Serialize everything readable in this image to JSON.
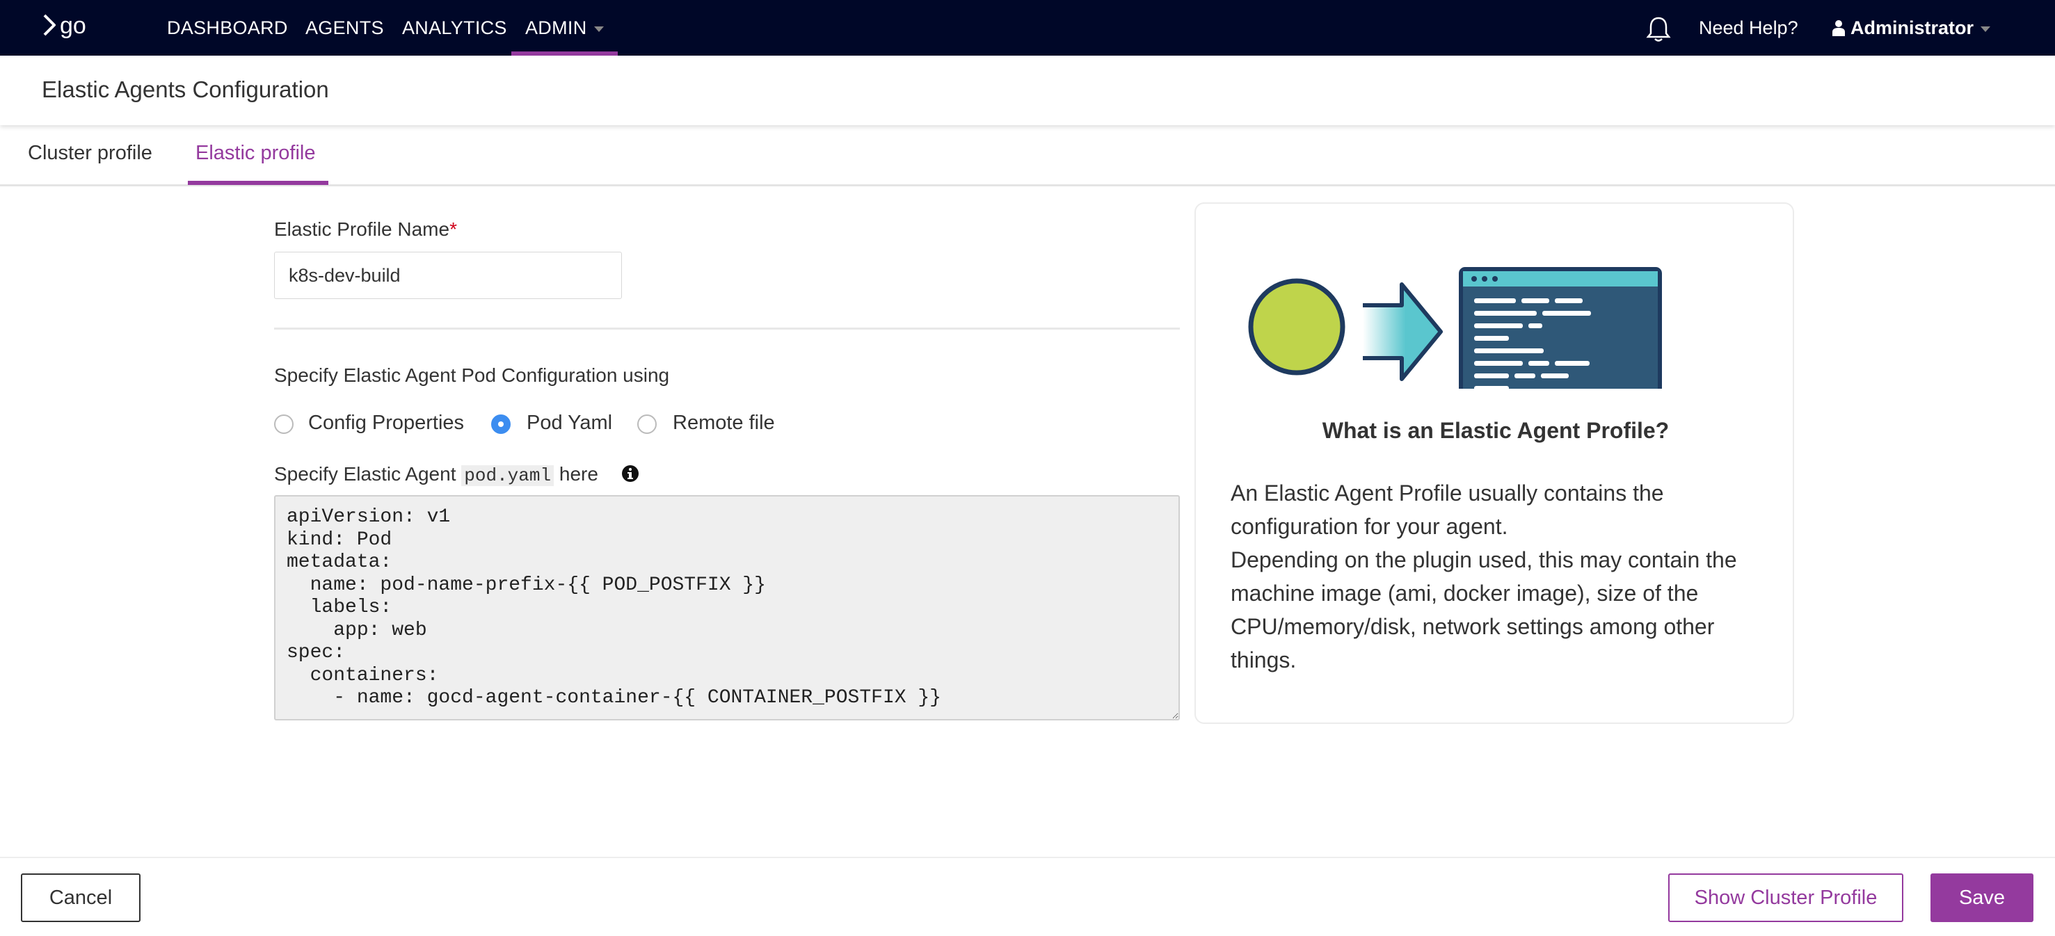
{
  "nav": {
    "logo_text": "go",
    "items": [
      "DASHBOARD",
      "AGENTS",
      "ANALYTICS",
      "ADMIN"
    ],
    "active_item": "ADMIN",
    "help_label": "Need Help?",
    "user_label": "Administrator"
  },
  "header": {
    "title": "Elastic Agents Configuration"
  },
  "tabs": [
    {
      "label": "Cluster profile",
      "active": false
    },
    {
      "label": "Elastic profile",
      "active": true
    }
  ],
  "form": {
    "name_label": "Elastic Profile Name",
    "name_required_marker": "*",
    "name_value": "k8s-dev-build",
    "pod_config_label": "Specify Elastic Agent Pod Configuration using",
    "radio_options": [
      {
        "label": "Config Properties",
        "checked": false
      },
      {
        "label": "Pod Yaml",
        "checked": true
      },
      {
        "label": "Remote file",
        "checked": false
      }
    ],
    "yaml_label_prefix": "Specify Elastic Agent",
    "yaml_label_code": "pod.yaml",
    "yaml_label_suffix": "here",
    "yaml_value": "apiVersion: v1\nkind: Pod\nmetadata:\n  name: pod-name-prefix-{{ POD_POSTFIX }}\n  labels:\n    app: web\nspec:\n  containers:\n    - name: gocd-agent-container-{{ CONTAINER_POSTFIX }}"
  },
  "info_card": {
    "title": "What is an Elastic Agent Profile?",
    "text": "An Elastic Agent Profile usually contains the configuration for your agent.\nDepending on the plugin used, this may contain the machine image (ami, docker image), size of the CPU/memory/disk, network settings among other things."
  },
  "footer": {
    "cancel_label": "Cancel",
    "show_cluster_label": "Show Cluster Profile",
    "save_label": "Save"
  },
  "colors": {
    "nav_bg": "#000728",
    "accent": "#943a9e",
    "radio_checked": "#3c8df0",
    "required": "#d0021b"
  }
}
